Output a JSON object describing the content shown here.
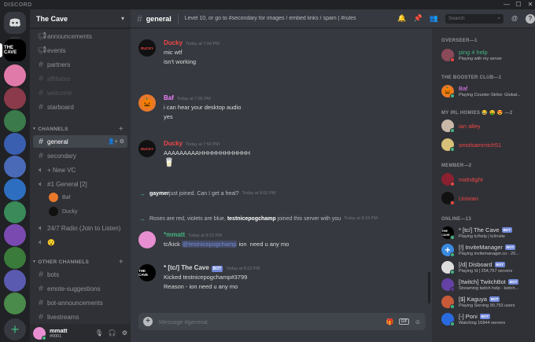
{
  "app": {
    "brand": "DISCORD"
  },
  "window": {
    "minimize": "—",
    "maximize": "☐",
    "close": "✕"
  },
  "servers": [
    {
      "name": "home",
      "label": "",
      "color": "#36393f"
    },
    {
      "name": "the-cave",
      "label": "THE CAVE",
      "color": "#000000"
    },
    {
      "name": "server-2",
      "label": "",
      "color": "#e07aa8"
    },
    {
      "name": "server-3",
      "label": "",
      "color": "#8a3a4a"
    },
    {
      "name": "server-4",
      "label": "",
      "color": "#3b7a4a"
    },
    {
      "name": "server-5",
      "label": "",
      "color": "#3a5fb0"
    },
    {
      "name": "server-6",
      "label": "",
      "color": "#4a6ab8"
    },
    {
      "name": "server-7",
      "label": "",
      "color": "#2e6ec0"
    },
    {
      "name": "server-8",
      "label": "",
      "color": "#3a8a5a"
    },
    {
      "name": "server-9",
      "label": "",
      "color": "#7a4ab0"
    },
    {
      "name": "server-10",
      "label": "",
      "color": "#3a7a3a"
    },
    {
      "name": "server-11",
      "label": "",
      "color": "#5a5ab0"
    },
    {
      "name": "server-12",
      "label": "",
      "color": "#4a8a4a"
    },
    {
      "name": "server-13",
      "label": "",
      "color": "#8a7a3a"
    },
    {
      "name": "add-server",
      "label": "+",
      "color": "#36393f"
    }
  ],
  "guild": {
    "name": "The Cave",
    "chevron": "▾"
  },
  "channels": {
    "top": [
      {
        "name": "announcements",
        "icon": "📢",
        "muted": false
      },
      {
        "name": "events",
        "icon": "📢",
        "muted": false
      },
      {
        "name": "partners",
        "icon": "#",
        "muted": false
      },
      {
        "name": "affiliates",
        "icon": "#",
        "muted": true
      },
      {
        "name": "welcome",
        "icon": "#",
        "muted": true
      },
      {
        "name": "starboard",
        "icon": "#",
        "muted": false
      }
    ],
    "cat1": {
      "label": "CHANNELS",
      "plus": "+"
    },
    "cat1_items": [
      {
        "name": "general",
        "icon": "#",
        "active": true
      },
      {
        "name": "secondary",
        "icon": "#",
        "active": false
      },
      {
        "name": "+ New VC",
        "icon": "🔊",
        "active": false
      },
      {
        "name": "#1 General [2]",
        "icon": "🔊",
        "active": false
      }
    ],
    "voice_users": [
      {
        "name": "Baf",
        "color": "#e8782a"
      },
      {
        "name": "Ducky",
        "color": "#111111"
      }
    ],
    "cat1_tail": [
      {
        "name": "24/7 Radio (Join to Listen)",
        "icon": "🔊"
      },
      {
        "name": "😯",
        "icon": "🔊"
      }
    ],
    "cat2": {
      "label": "OTHER CHANNELS",
      "plus": "+"
    },
    "cat2_items": [
      {
        "name": "bots",
        "icon": "#"
      },
      {
        "name": "emote-suggestions",
        "icon": "#"
      },
      {
        "name": "bot-announcements",
        "icon": "#"
      },
      {
        "name": "livestreams",
        "icon": "#"
      }
    ]
  },
  "user": {
    "name": "mmatt",
    "tag": "#0001",
    "mic": "🎙",
    "deafen": "🎧",
    "settings": "⚙"
  },
  "header": {
    "channel": "general",
    "topic": "Level 10, or go to #secondary for images / embed links / spam | #rules",
    "search_placeholder": "Search",
    "icons": {
      "bell": "🔔",
      "pin": "📌",
      "members": "👥",
      "search": "🔍",
      "mention": "@",
      "help": "?"
    }
  },
  "messages": [
    {
      "author": "Ducky",
      "color": "#f04747",
      "avatar": "#111111",
      "avatar_label": "DUCKY",
      "time": "Today at 7:04 PM",
      "bot": false,
      "lines": [
        "mic wtf",
        "isn't working"
      ]
    },
    {
      "author": "Baf",
      "color": "#f47fff",
      "avatar": "#e8782a",
      "avatar_label": "🎃",
      "time": "Today at 7:05 PM",
      "bot": false,
      "lines": [
        "i can hear your desktop audio",
        "yes"
      ]
    },
    {
      "author": "Ducky",
      "color": "#f04747",
      "avatar": "#111111",
      "avatar_label": "DUCKY",
      "time": "Today at 7:50 PM",
      "bot": false,
      "lines": [
        "AAAAAAAAAHHHHHHHHHHHH",
        "🥛"
      ]
    }
  ],
  "system": [
    {
      "arrow": "→",
      "who": "gaymer",
      "text": " just joined. Can I get a heal?",
      "time": "Today at 8:02 PM"
    },
    {
      "arrow": "→",
      "who": "",
      "text": "Roses are red, violets are blue, ",
      "who2": "testnicepogchamp",
      "text2": " joined this server with you",
      "time": "Today at 8:18 PM"
    }
  ],
  "message4": {
    "author": "*mmatt",
    "color": "#43b581",
    "avatar": "#e88fd1",
    "time": "Today at 8:22 PM",
    "pre": "tc/kick ",
    "mention": "@testnicepogchamp",
    "post": " ion  need u any mo"
  },
  "message5": {
    "author": "* [tc/] The Cave",
    "color": "#b9bbbe",
    "avatar": "#000000",
    "avatar_label": "THE CAVE",
    "time": "Today at 8:22 PM",
    "bot": "BOT",
    "lines": [
      "Kicked testnicepogchamp#3799",
      "Reason - ion  need u any mo"
    ]
  },
  "composer": {
    "placeholder": "Message #general",
    "add": "+",
    "gift": "🎁",
    "gif": "GIF",
    "emoji": "☺"
  },
  "member_groups": [
    {
      "label": "OVERSEER—1"
    },
    {
      "label": "THE BOOSTER CLUB—1"
    },
    {
      "label": "MY IRL HOMIES 😂 🤑 😍 —2"
    },
    {
      "label": "MEMBER—2"
    },
    {
      "label": "ONLINE—13"
    }
  ],
  "members": [
    {
      "name": "ping 4 help",
      "color": "#43b581",
      "avatar": "#8a4a5a",
      "activity": "Playing with my server",
      "status": "#f04747",
      "bot": ""
    },
    {
      "name": "Baf",
      "color": "#f47fff",
      "avatar": "#e8782a",
      "activity": "Playing Counter-Strike: Global...",
      "status": "#43b581",
      "bot": ""
    },
    {
      "name": "ian alley",
      "color": "#f04747",
      "avatar": "#c9b8a8",
      "activity": "",
      "status": "#43b581",
      "bot": ""
    },
    {
      "name": "smolsammich51",
      "color": "#f04747",
      "avatar": "#d8c078",
      "activity": "",
      "status": "#43b581",
      "bot": ""
    },
    {
      "name": "midn8ght",
      "color": "#f04747",
      "avatar": "#8a2030",
      "activity": "",
      "status": "#f04747",
      "bot": ""
    },
    {
      "name": "Unixian",
      "color": "#f04747",
      "avatar": "#111111",
      "activity": "",
      "status": "#f04747",
      "bot": ""
    },
    {
      "name": "* [tc/] The Cave",
      "color": "#dcddde",
      "avatar": "#000000",
      "activity": "Playing tc/help | tc/invite",
      "status": "#43b581",
      "bot": "BOT"
    },
    {
      "name": "[!] InviteManager",
      "color": "#dcddde",
      "avatar": "#3a8ae0",
      "activity": "Playing invitemanager.co - 20...",
      "status": "#43b581",
      "bot": "BOT"
    },
    {
      "name": "[/d] Disboard",
      "color": "#dcddde",
      "avatar": "#dddddd",
      "activity": "Playing !d | 254,757 servers",
      "status": "#43b581",
      "bot": "BOT"
    },
    {
      "name": "[!twitch] TwitchBot",
      "color": "#dcddde",
      "avatar": "#6441a5",
      "activity": "Streaming twitch help - twitch...",
      "status": "#593695",
      "bot": "BOT"
    },
    {
      "name": "[$] Kaguya",
      "color": "#dcddde",
      "avatar": "#c85a3a",
      "activity": "Playing Serving 90,753 users",
      "status": "#43b581",
      "bot": "BOT"
    },
    {
      "name": "[-] Poni",
      "color": "#dcddde",
      "avatar": "#2a6ae0",
      "activity": "Watching 16844 servers",
      "status": "#43b581",
      "bot": "BOT"
    }
  ]
}
